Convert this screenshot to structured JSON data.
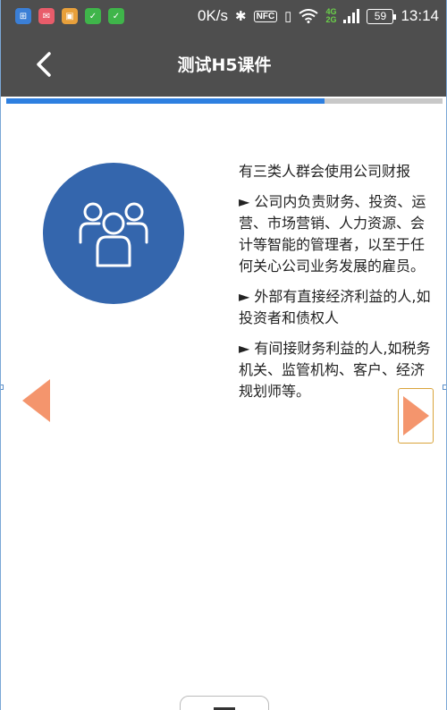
{
  "status_bar": {
    "network_speed": "0K/s",
    "network_labels": [
      "4G",
      "2G"
    ],
    "battery": "59",
    "time": "13:14",
    "nfc_label": "NFC",
    "app_icons": [
      "app-icon-1",
      "app-icon-2",
      "app-icon-3",
      "app-icon-4",
      "app-icon-5"
    ]
  },
  "header": {
    "title": "测试H5课件"
  },
  "progress": {
    "fraction": 0.73,
    "fill_color": "#2d7fe0"
  },
  "content": {
    "heading": "有三类人群会使用公司财报",
    "bullets": [
      "► 公司内负责财务、投资、运营、市场营销、人力资源、会计等智能的管理者，以至于任何关心公司业务发展的雇员。",
      "► 外部有直接经济利益的人,如投资者和债权人",
      "► 有间接财务利益的人,如税务机关、监管机构、客户、经济规划师等。"
    ],
    "icon": "people-group-icon",
    "icon_bg": "#3466ad"
  },
  "nav": {
    "prev_icon": "arrow-left-icon",
    "next_icon": "arrow-right-icon",
    "arrow_color": "#f4956d"
  }
}
